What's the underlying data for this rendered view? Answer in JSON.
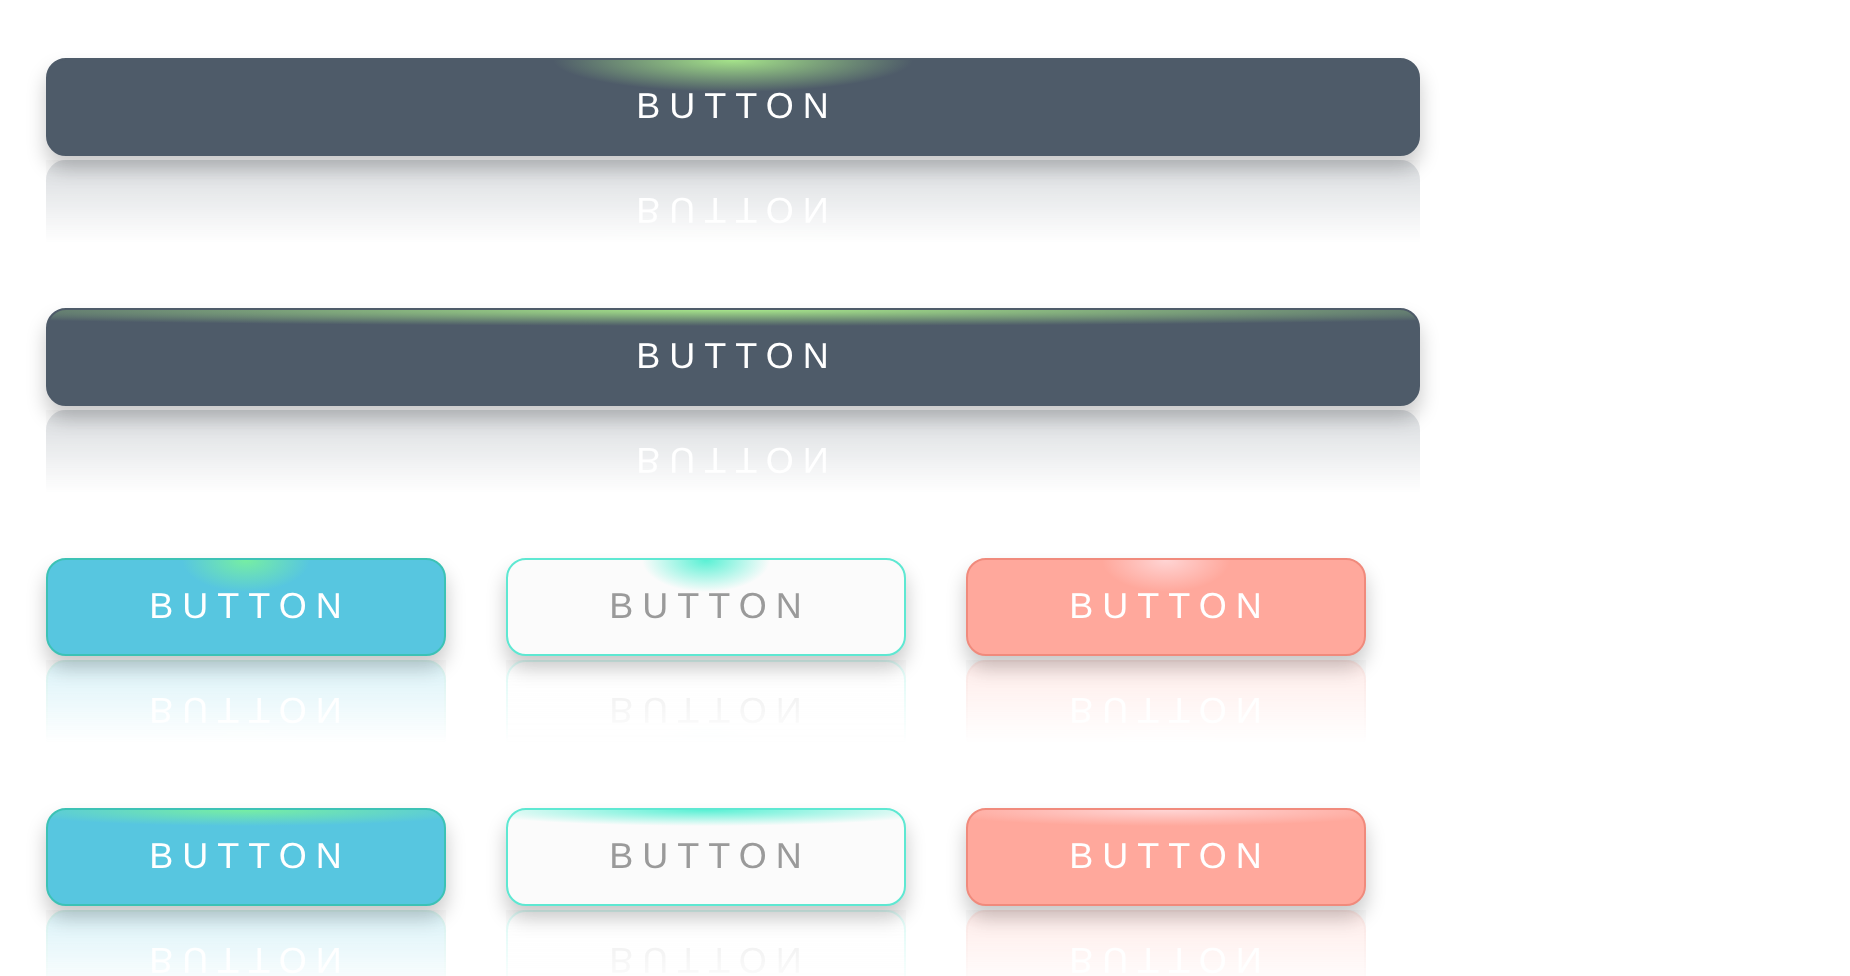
{
  "rows": [
    {
      "kind": "spot",
      "buttons": [
        {
          "label": "BUTTON",
          "kind": "dark"
        }
      ]
    },
    {
      "kind": "band",
      "buttons": [
        {
          "label": "BUTTON",
          "kind": "dark"
        }
      ]
    },
    {
      "kind": "spot",
      "buttons": [
        {
          "label": "BUTTON",
          "kind": "info"
        },
        {
          "label": "BUTTON",
          "kind": "light"
        },
        {
          "label": "BUTTON",
          "kind": "danger"
        }
      ]
    },
    {
      "kind": "band",
      "buttons": [
        {
          "label": "BUTTON",
          "kind": "info"
        },
        {
          "label": "BUTTON",
          "kind": "light"
        },
        {
          "label": "BUTTON",
          "kind": "danger"
        }
      ]
    }
  ]
}
